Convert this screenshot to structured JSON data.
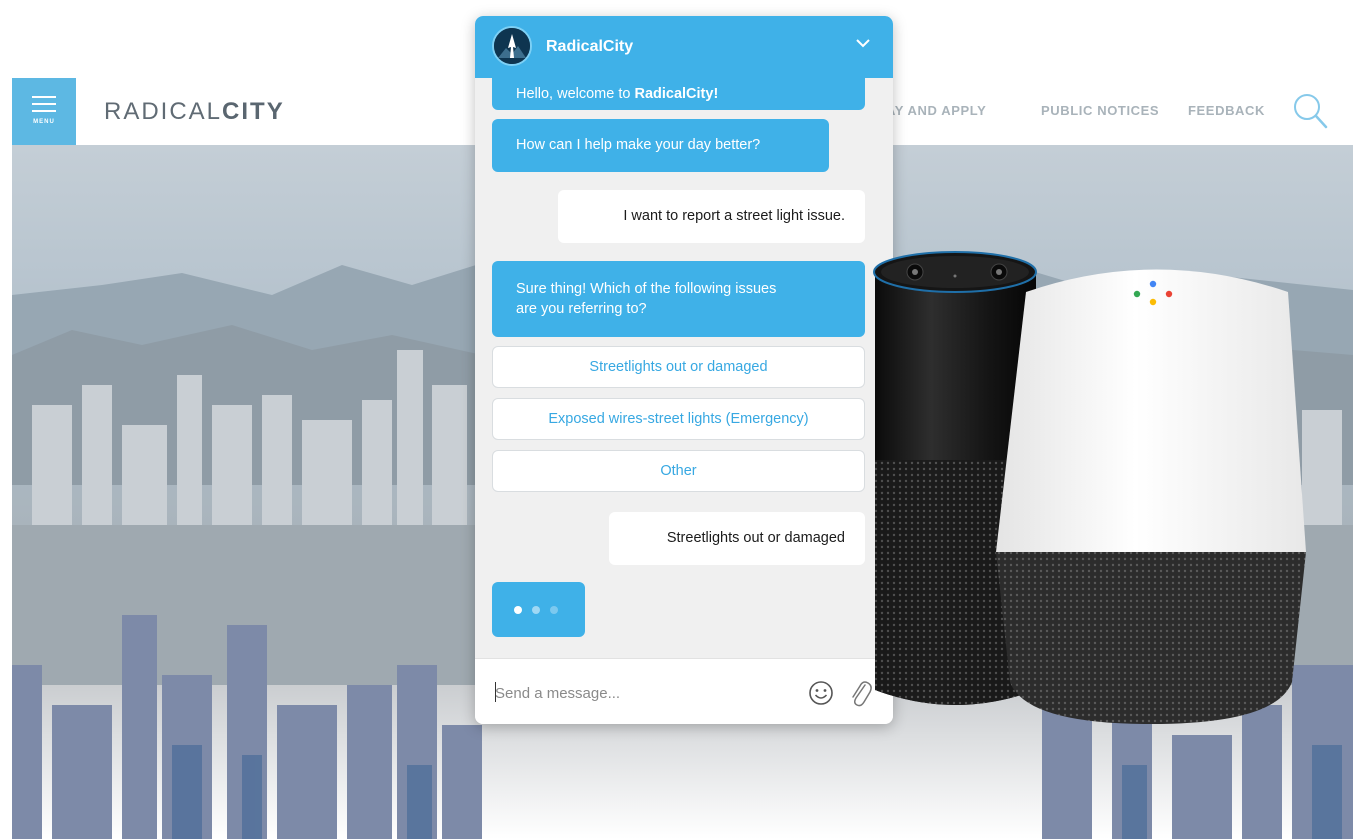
{
  "site": {
    "menu_label": "MENU",
    "logo_light": "RADICAL",
    "logo_bold": "CITY",
    "nav": [
      "AY AND APPLY",
      "PUBLIC NOTICES",
      "FEEDBACK"
    ]
  },
  "chat": {
    "title": "RadicalCity",
    "messages": {
      "bot_welcome_prefix": "Hello, welcome to ",
      "bot_welcome_name": "RadicalCity!",
      "bot_help": "How can I help make your day better?",
      "user_report": "I want to report a street light issue.",
      "bot_question_line1": "Sure thing! Which of the following issues",
      "bot_question_line2": "are you referring to?",
      "user_choice": "Streetlights out or damaged"
    },
    "options": [
      "Streetlights out or damaged",
      "Exposed wires-street lights (Emergency)",
      "Other"
    ],
    "input_placeholder": "Send a message..."
  },
  "colors": {
    "accent": "#3fb1e8",
    "menu_button": "#5db8e3",
    "option_text": "#37a8e2",
    "google_dots": [
      "#4285f4",
      "#ea4335",
      "#fbbc05",
      "#34a853"
    ]
  },
  "icons": [
    "menu-icon",
    "search-icon",
    "chevron-down-icon",
    "smiley-icon",
    "paperclip-icon"
  ]
}
